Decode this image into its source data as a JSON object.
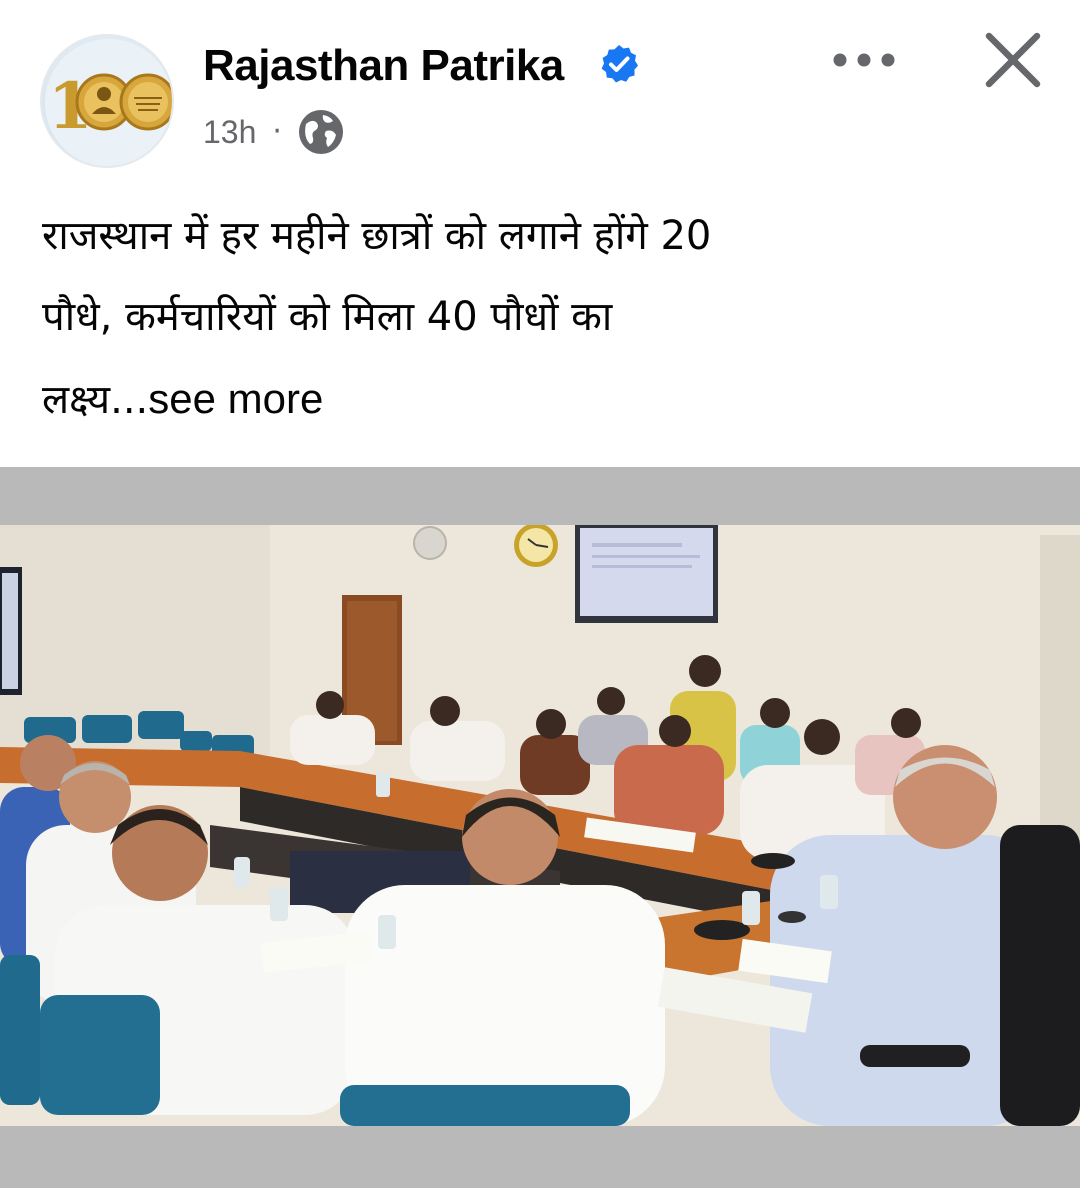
{
  "header": {
    "page_name": "Rajasthan Patrika",
    "time": "13h",
    "separator": "·",
    "verified_icon": "verified-badge-icon",
    "privacy_icon": "globe-icon",
    "more_icon": "more-horizontal-icon",
    "close_icon": "close-icon",
    "verified_color": "#1877f2",
    "logo_text": "100"
  },
  "post": {
    "line1": "राजस्थान में हर महीने छात्रों को लगाने होंगे 20",
    "line2": "पौधे, कर्मचारियों को मिला 40 पौधों का",
    "line3": "लक्ष्य...",
    "see_more": "see more"
  },
  "colors": {
    "text": "#050505",
    "secondary_text": "#65676b",
    "photo_frame": "#b9b9b9"
  }
}
